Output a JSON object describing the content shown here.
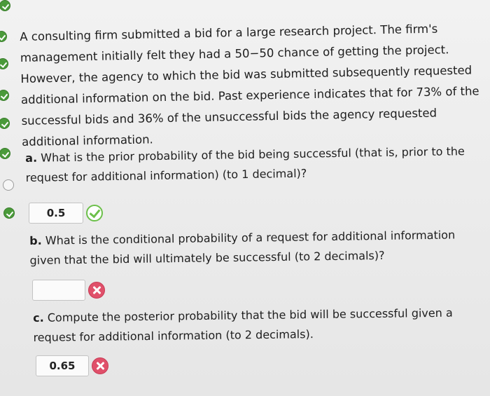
{
  "question": {
    "intro_lines": [
      "A consulting firm submitted a bid for a large research project. The firm's",
      "management initially felt they had a 50−50 chance of getting the project.",
      "However, the agency to which the bid was submitted subsequently requested",
      "additional information on the bid. Past experience indicates that for 73% of the",
      "successful bids and 36% of the unsuccessful bids the agency requested",
      "additional information."
    ],
    "part_a": {
      "label": "a.",
      "text_line1": "What is the prior probability of the bid being successful (that is, prior to the",
      "text_line2": "request for additional information) (to 1 decimal)?",
      "answer": "0.5",
      "status": "correct"
    },
    "part_b": {
      "label": "b.",
      "text_line1": "What is the conditional probability of a request for additional information",
      "text_line2": "given that the bid will ultimately be successful (to 2 decimals)?",
      "answer": "",
      "status": "incorrect"
    },
    "part_c": {
      "label": "c.",
      "text_line1": "Compute the posterior probability that the bid will be successful given a",
      "text_line2": "request for additional information (to 2 decimals).",
      "answer": "0.65",
      "status": "incorrect"
    }
  },
  "gutter": {
    "dots": [
      "complete",
      "complete",
      "complete",
      "complete",
      "complete",
      "complete",
      "empty",
      "complete"
    ]
  },
  "colors": {
    "correct": "#6cc04a",
    "incorrect": "#e0506a",
    "done_dot": "#4a9a3a"
  },
  "icons": {
    "correct": "check-circle-icon",
    "incorrect": "x-circle-icon"
  }
}
